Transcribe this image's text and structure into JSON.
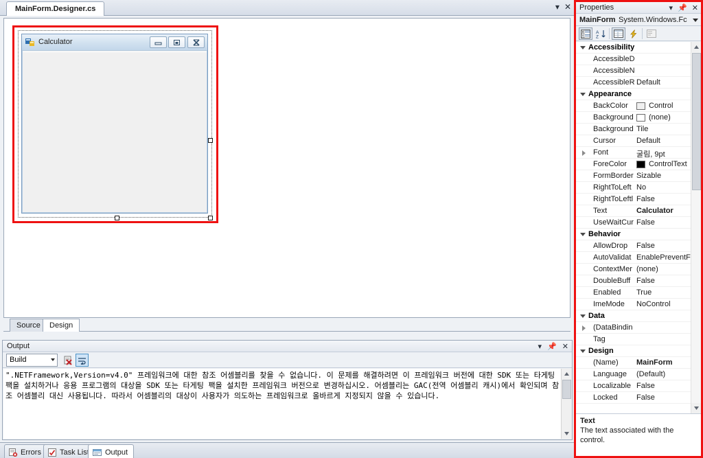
{
  "editor": {
    "tab_label": "MainForm.Designer.cs",
    "window_buttons": [
      "dropdown",
      "close"
    ],
    "view_tabs": [
      {
        "label": "Source",
        "active": false
      },
      {
        "label": "Design",
        "active": true
      }
    ]
  },
  "designer": {
    "form": {
      "caption": "Calculator",
      "icon": "winform-icon",
      "minimize_label": "–",
      "maximize_label": "□",
      "close_label": "✕"
    },
    "selection": {
      "handles": 3
    }
  },
  "output": {
    "title": "Output",
    "source_label": "Build",
    "buttons": [
      "clear-output",
      "word-wrap"
    ],
    "head_buttons": [
      "dropdown",
      "pin",
      "close"
    ],
    "text": "\".NETFramework,Version=v4.0\" 프레임워크에 대한 참조 어셈블리를 찾을 수 없습니다. 이 문제를 해결하려면 이 프레임워크 버전에 대한 SDK 또는 타게팅 팩을 설치하거나 응용 프로그램의 대상을 SDK 또는 타게팅 팩을 설치한 프레임워크 버전으로 변경하십시오. 어셈블리는 GAC(전역 어셈블리 캐시)에서 확인되며 참조 어셈블리 대신 사용됩니다. 따라서 어셈블리의 대상이 사용자가 의도하는 프레임워크로 올바르게 지정되지 않을 수 있습니다."
  },
  "bottom_tabs": [
    {
      "label": "Errors",
      "icon": "errors-icon",
      "active": false
    },
    {
      "label": "Task List",
      "icon": "tasklist-icon",
      "active": false
    },
    {
      "label": "Output",
      "icon": "output-icon",
      "active": true
    }
  ],
  "properties": {
    "title": "Properties",
    "head_buttons": [
      "dropdown",
      "pin",
      "close"
    ],
    "object_name": "MainForm",
    "object_type": "System.Windows.Fc",
    "toolbar": [
      {
        "name": "categorized",
        "pressed": true
      },
      {
        "name": "alphabetical",
        "pressed": false
      },
      {
        "name": "properties",
        "pressed": true
      },
      {
        "name": "events",
        "pressed": false
      },
      {
        "name": "property-pages",
        "pressed": false
      }
    ],
    "rows": [
      {
        "kind": "category",
        "label": "Accessibility"
      },
      {
        "kind": "prop",
        "name": "AccessibleD",
        "value": ""
      },
      {
        "kind": "prop",
        "name": "AccessibleN",
        "value": ""
      },
      {
        "kind": "prop",
        "name": "AccessibleR",
        "value": "Default"
      },
      {
        "kind": "category",
        "label": "Appearance"
      },
      {
        "kind": "prop",
        "name": "BackColor",
        "value": "Control",
        "swatch": "#f0f0f0"
      },
      {
        "kind": "prop",
        "name": "Background",
        "value": "(none)",
        "swatch": "#ffffff"
      },
      {
        "kind": "prop",
        "name": "Background",
        "value": "Tile"
      },
      {
        "kind": "prop",
        "name": "Cursor",
        "value": "Default"
      },
      {
        "kind": "prop",
        "name": "Font",
        "value": "굴림, 9pt",
        "expandable": true
      },
      {
        "kind": "prop",
        "name": "ForeColor",
        "value": "ControlText",
        "swatch": "#000000"
      },
      {
        "kind": "prop",
        "name": "FormBorder",
        "value": "Sizable"
      },
      {
        "kind": "prop",
        "name": "RightToLeft",
        "value": "No"
      },
      {
        "kind": "prop",
        "name": "RightToLeftl",
        "value": "False"
      },
      {
        "kind": "prop",
        "name": "Text",
        "value": "Calculator",
        "bold": true
      },
      {
        "kind": "prop",
        "name": "UseWaitCur",
        "value": "False"
      },
      {
        "kind": "category",
        "label": "Behavior"
      },
      {
        "kind": "prop",
        "name": "AllowDrop",
        "value": "False"
      },
      {
        "kind": "prop",
        "name": "AutoValidat",
        "value": "EnablePreventFc"
      },
      {
        "kind": "prop",
        "name": "ContextMer",
        "value": "(none)"
      },
      {
        "kind": "prop",
        "name": "DoubleBuff",
        "value": "False"
      },
      {
        "kind": "prop",
        "name": "Enabled",
        "value": "True"
      },
      {
        "kind": "prop",
        "name": "ImeMode",
        "value": "NoControl"
      },
      {
        "kind": "category",
        "label": "Data"
      },
      {
        "kind": "prop",
        "name": "(DataBindin",
        "value": "",
        "expandable": true
      },
      {
        "kind": "prop",
        "name": "Tag",
        "value": ""
      },
      {
        "kind": "category",
        "label": "Design"
      },
      {
        "kind": "prop",
        "name": "(Name)",
        "value": "MainForm",
        "bold": true
      },
      {
        "kind": "prop",
        "name": "Language",
        "value": "(Default)"
      },
      {
        "kind": "prop",
        "name": "Localizable",
        "value": "False"
      },
      {
        "kind": "prop",
        "name": "Locked",
        "value": "False"
      }
    ],
    "description": {
      "title": "Text",
      "body": "The text associated with the control."
    }
  },
  "colors": {
    "annotation": "#ee1111",
    "accent": "#4a90c4"
  }
}
